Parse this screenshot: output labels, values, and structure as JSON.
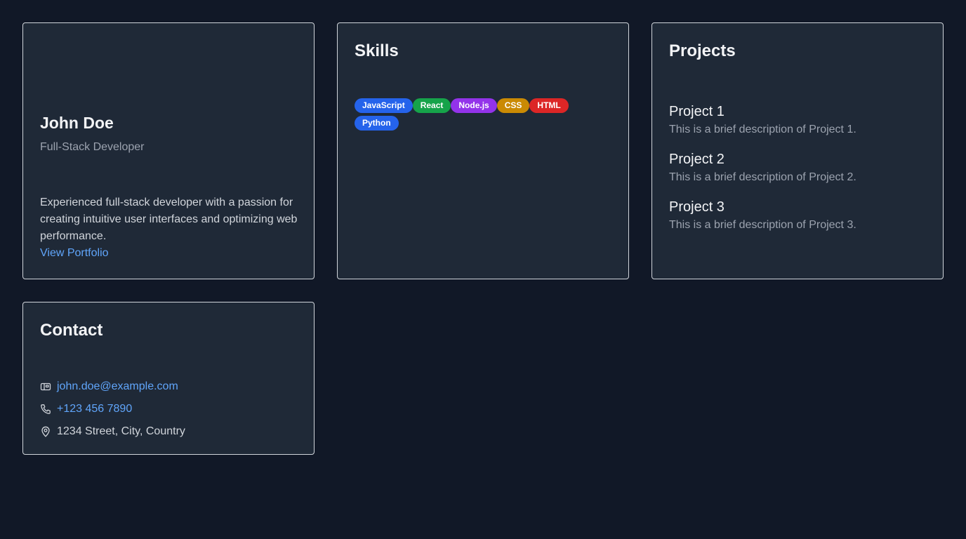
{
  "profile": {
    "name": "John Doe",
    "role": "Full-Stack Developer",
    "bio": "Experienced full-stack developer with a passion for creating intuitive user interfaces and optimizing web performance.",
    "link_label": "View Portfolio"
  },
  "skills": {
    "title": "Skills",
    "items": [
      {
        "label": "JavaScript",
        "color": "#2563eb"
      },
      {
        "label": "React",
        "color": "#16a34a"
      },
      {
        "label": "Node.js",
        "color": "#9333ea"
      },
      {
        "label": "CSS",
        "color": "#ca8a04"
      },
      {
        "label": "HTML",
        "color": "#dc2626"
      },
      {
        "label": "Python",
        "color": "#2563eb"
      }
    ]
  },
  "projects": {
    "title": "Projects",
    "items": [
      {
        "name": "Project 1",
        "description": "This is a brief description of Project 1."
      },
      {
        "name": "Project 2",
        "description": "This is a brief description of Project 2."
      },
      {
        "name": "Project 3",
        "description": "This is a brief description of Project 3."
      }
    ]
  },
  "contact": {
    "title": "Contact",
    "email": {
      "icon": "mail-icon",
      "value": "john.doe@example.com"
    },
    "phone": {
      "icon": "phone-icon",
      "value": "+123 456 7890"
    },
    "address": {
      "icon": "location-pin-icon",
      "value": "1234 Street, City, Country"
    }
  },
  "colors": {
    "background": "#111827",
    "card": "#1f2937",
    "accent": "#60a5fa"
  }
}
